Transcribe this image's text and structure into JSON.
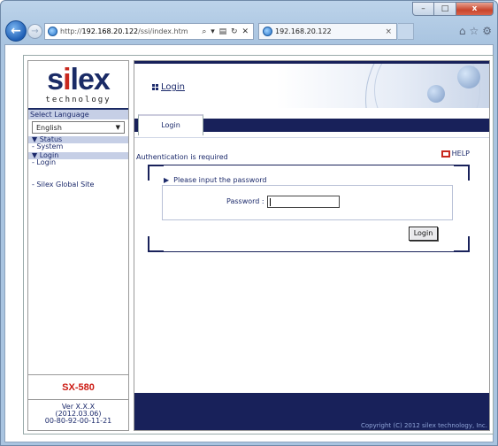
{
  "browser": {
    "address": {
      "url_prefix": "http://",
      "url_host": "192.168.20.122",
      "url_path": "/ssi/index.htm",
      "actions": "⌕ ▾ ▤ ↻ ✕"
    },
    "tab": {
      "title": "192.168.20.122",
      "close": "×"
    },
    "window_controls": {
      "minimize": "–",
      "maximize": "□",
      "close": "x"
    },
    "tools": {
      "home": "⌂",
      "favorites": "☆",
      "settings": "⚙"
    },
    "back": "←",
    "forward": "→"
  },
  "sidebar": {
    "logo": {
      "brand_pre": "s",
      "brand_i": "i",
      "brand_post": "lex",
      "sub": "technology"
    },
    "language": {
      "heading": "Select Language",
      "selected": "English",
      "arrow": "▼"
    },
    "menu": [
      {
        "heading": "▼ Status",
        "items": [
          "- System"
        ]
      },
      {
        "heading": "▼ Login",
        "items": [
          "- Login"
        ]
      }
    ],
    "global_site": "- Silex Global Site",
    "model": "SX-580",
    "version": [
      "Ver X.X.X",
      "(2012.03.06)",
      "00-80-92-00-11-21"
    ]
  },
  "main": {
    "title": "Login",
    "tab": "Login",
    "auth_message": "Authentication is required",
    "help": "HELP",
    "prompt": "Please input the password",
    "prompt_marker": "▶",
    "password_label": "Password :",
    "password_value": "",
    "login_button": "Login",
    "copyright": "Copyright (C) 2012 silex technology, Inc."
  },
  "colors": {
    "navy": "#18215a",
    "menu_bg": "#c6cfe6",
    "model_red": "#cc1a12",
    "link_text": "#1c2a6b"
  }
}
